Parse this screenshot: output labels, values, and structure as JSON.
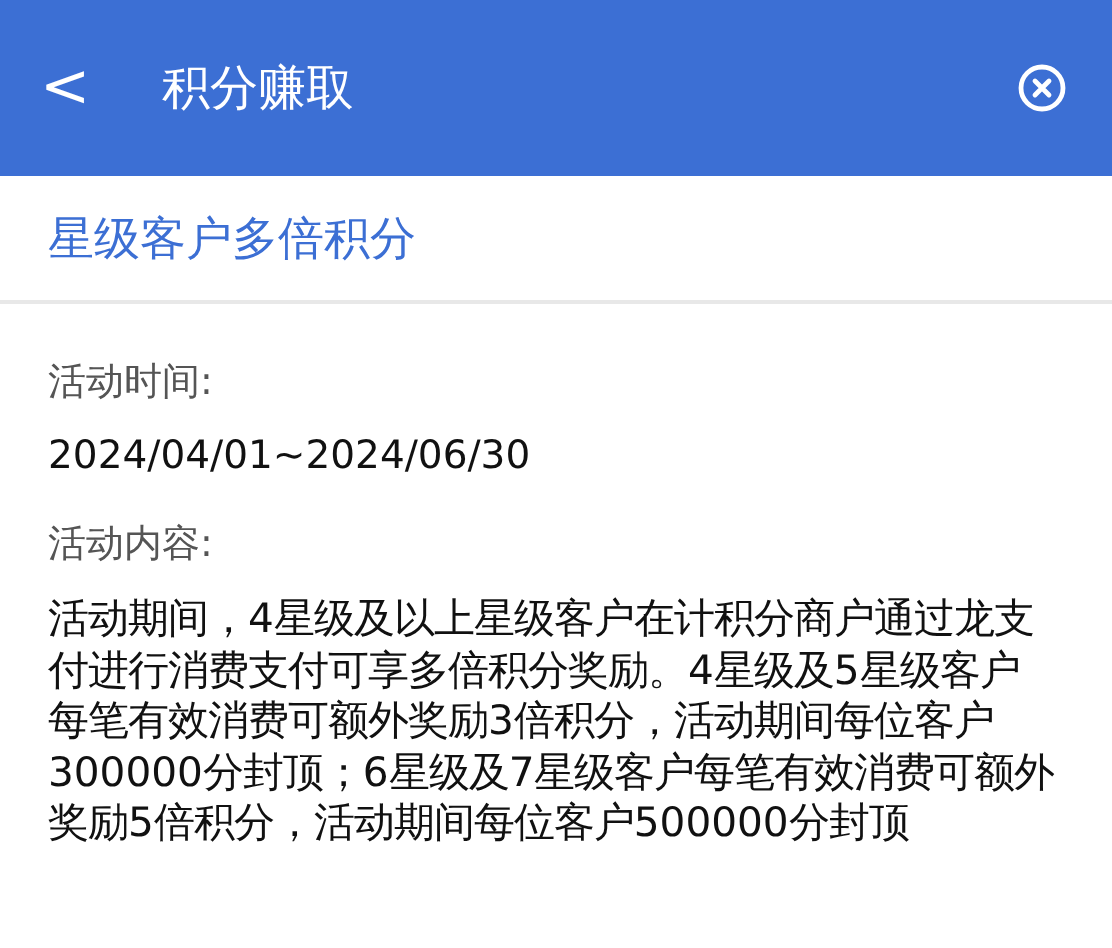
{
  "header": {
    "back_icon": "<",
    "title": "积分赚取"
  },
  "subtitle": "星级客户多倍积分",
  "sections": [
    {
      "label": "活动时间:",
      "text": "2024/04/01~2024/06/30"
    },
    {
      "label": "活动内容:",
      "text": "活动期间，4星级及以上星级客户在计积分商户通过龙支付进行消费支付可享多倍积分奖励。4星级及5星级客户每笔有效消费可额外奖励3倍积分，活动期间每位客户300000分封顶；6星级及7星级客户每笔有效消费可额外奖励5倍积分，活动期间每位客户500000分封顶"
    }
  ]
}
